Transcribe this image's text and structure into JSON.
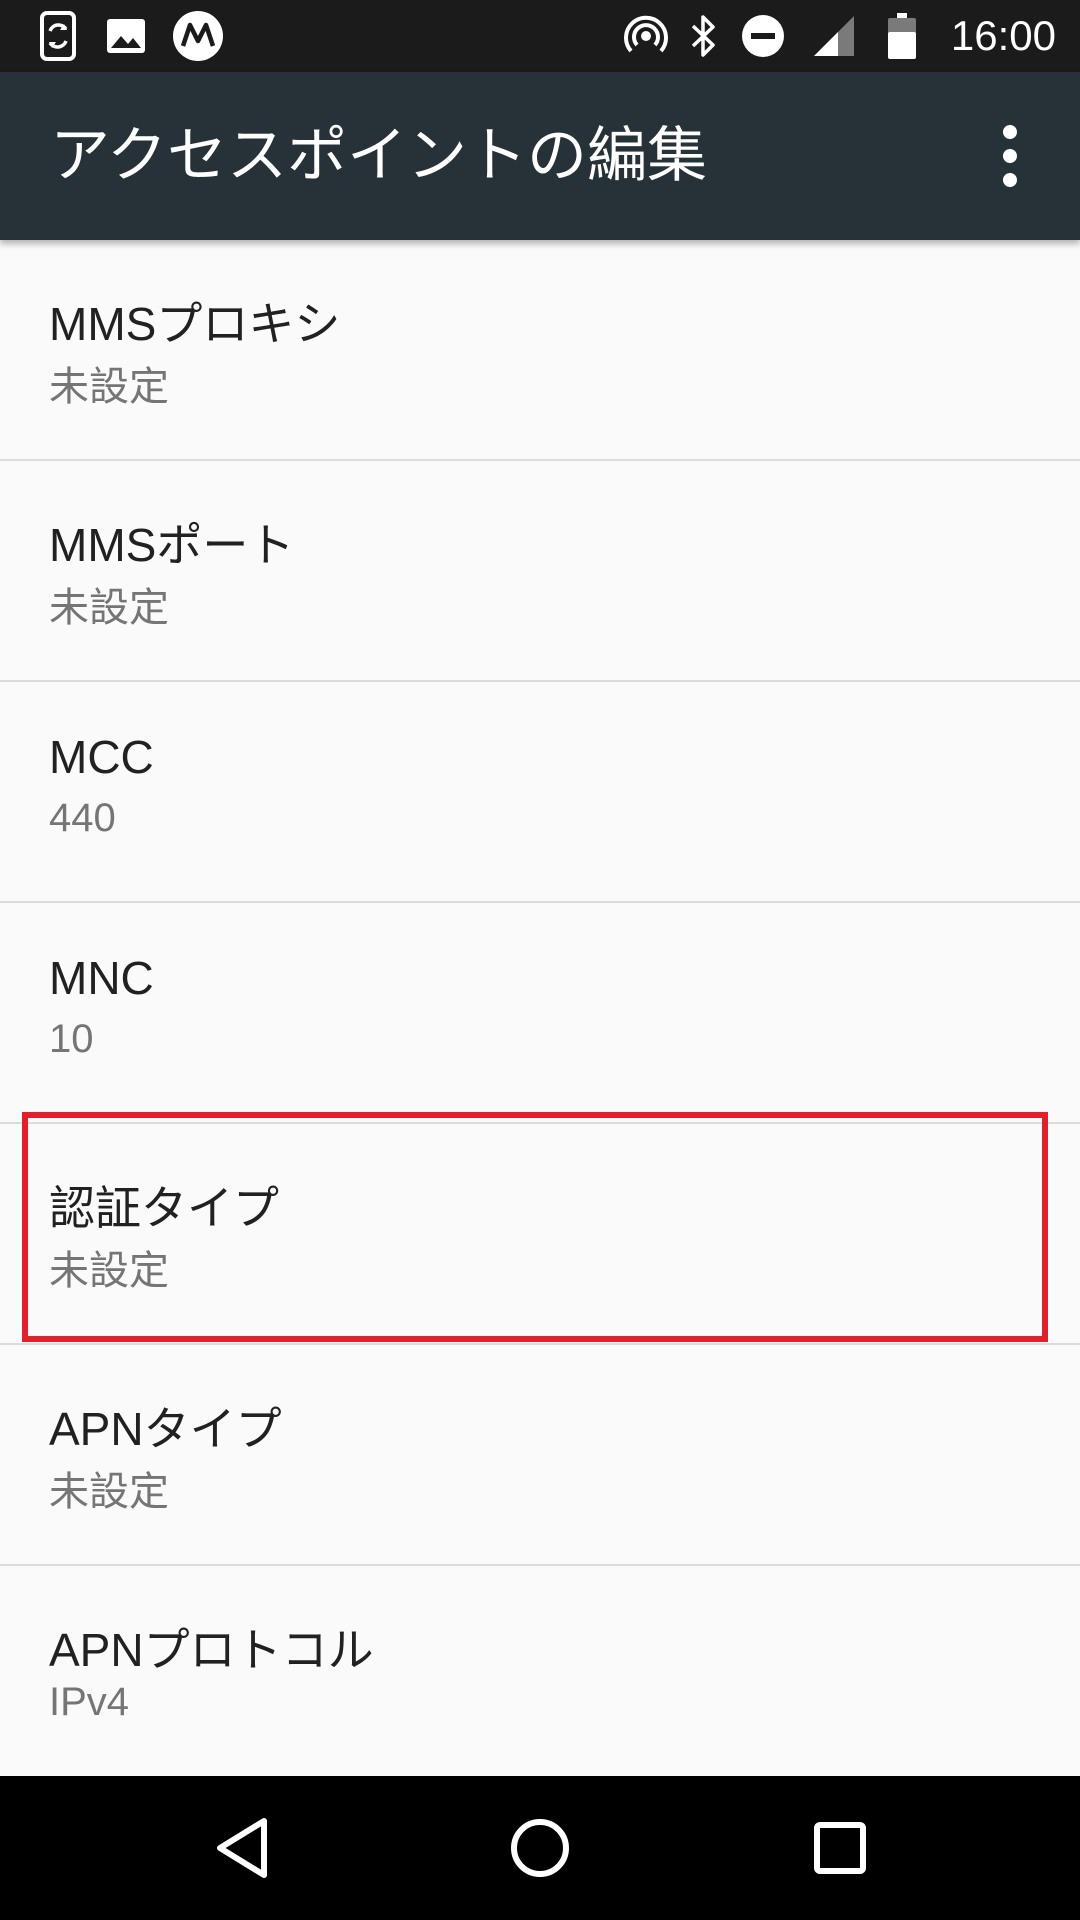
{
  "status_bar": {
    "time": "16:00",
    "icons": [
      "sync-phone-icon",
      "image-icon",
      "motorola-icon",
      "hotspot-icon",
      "bluetooth-icon",
      "do-not-disturb-icon",
      "signal-icon",
      "battery-icon"
    ]
  },
  "app_bar": {
    "title": "アクセスポイントの編集",
    "overflow_icon": "more-vert-icon"
  },
  "settings": [
    {
      "title": "MMSプロキシ",
      "summary": "未設定"
    },
    {
      "title": "MMSポート",
      "summary": "未設定"
    },
    {
      "title": "MCC",
      "summary": "440"
    },
    {
      "title": "MNC",
      "summary": "10"
    },
    {
      "title": "認証タイプ",
      "summary": "未設定"
    },
    {
      "title": "APNタイプ",
      "summary": "未設定"
    },
    {
      "title": "APNプロトコル",
      "summary": "IPv4"
    }
  ],
  "highlight": {
    "target": "認証タイプ",
    "color": "#e0202b"
  },
  "nav_bar": {
    "icons": [
      "back-icon",
      "home-icon",
      "recents-icon"
    ]
  },
  "colors": {
    "app_bar": "#263238",
    "status_bar": "#1b1b1b",
    "background": "#fafafa"
  }
}
